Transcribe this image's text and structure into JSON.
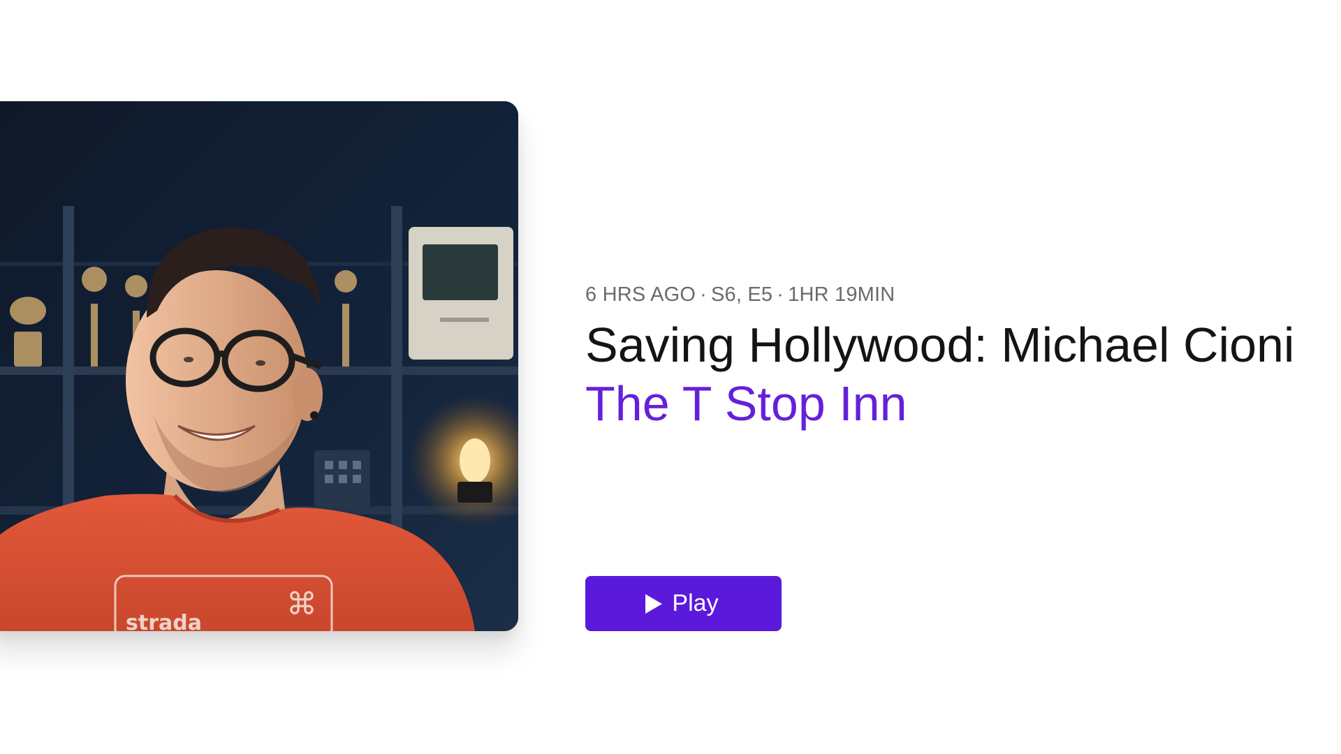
{
  "episode": {
    "published": "6 HRS AGO",
    "season_episode": "S6, E5",
    "duration": "1HR 19MIN",
    "separator": "·",
    "title": "Saving Hollywood: Michael Cioni",
    "show_name": "The T Stop Inn",
    "artwork_shirt_text": "strada"
  },
  "actions": {
    "play_label": "Play",
    "play_icon": "play-triangle-icon"
  },
  "colors": {
    "accent": "#5b1adb",
    "show_link": "#6520d9",
    "title": "#141414",
    "meta": "#6a6a6a",
    "background": "#ffffff"
  }
}
